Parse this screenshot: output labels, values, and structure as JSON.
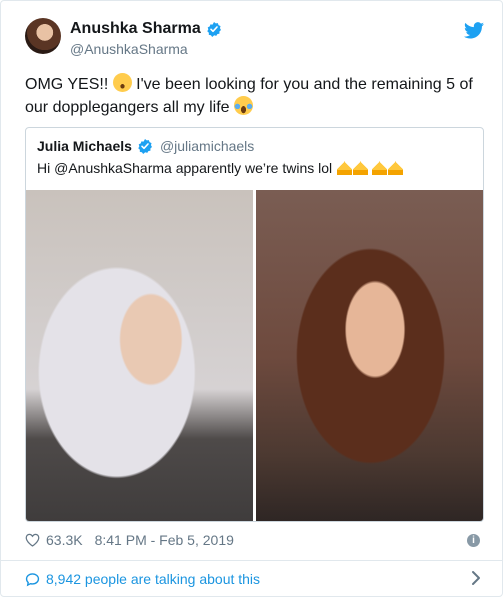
{
  "author": {
    "name": "Anushka Sharma",
    "handle": "@AnushkaSharma",
    "verified": true
  },
  "tweet": {
    "text_part1": "OMG YES!! ",
    "text_part2": " I've been looking for you and the remaining 5 of our dopplegangers all my life ",
    "emojis": [
      "hushed-face-emoji",
      "tears-of-joy-emoji"
    ]
  },
  "quoted_tweet": {
    "name": "Julia Michaels",
    "handle": "@juliamichaels",
    "verified": true,
    "text": "Hi @AnushkaSharma apparently we’re twins lol ",
    "emojis": [
      "crown-emoji",
      "crown-emoji",
      "crown-emoji",
      "crown-emoji"
    ],
    "images": [
      "julia-michaels-photo",
      "anushka-sharma-photo"
    ]
  },
  "meta": {
    "likes": "63.3K",
    "timestamp": "8:41 PM - Feb 5, 2019"
  },
  "footer": {
    "talking_text": "8,942 people are talking about this"
  },
  "colors": {
    "accent": "#1b95e0",
    "verified": "#1da1f2",
    "muted": "#657786",
    "border": "#e1e8ed"
  }
}
